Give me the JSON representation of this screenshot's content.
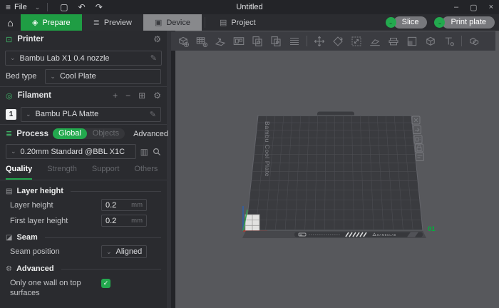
{
  "titlebar": {
    "menu": "File",
    "title": "Untitled"
  },
  "nav": {
    "prepare": "Prepare",
    "preview": "Preview",
    "device": "Device",
    "project": "Project",
    "slice": "Slice",
    "print_plate": "Print plate"
  },
  "printer": {
    "title": "Printer",
    "model": "Bambu Lab X1 0.4 nozzle",
    "bed_type_label": "Bed type",
    "bed_type_value": "Cool Plate"
  },
  "filament": {
    "title": "Filament",
    "slot": "1",
    "material": "Bambu PLA Matte"
  },
  "process": {
    "title": "Process",
    "scope_global": "Global",
    "scope_objects": "Objects",
    "advanced_label": "Advanced",
    "preset": "0.20mm Standard @BBL X1C",
    "tab_quality": "Quality",
    "tab_strength": "Strength",
    "tab_support": "Support",
    "tab_others": "Others"
  },
  "quality": {
    "group_layer_height": "Layer height",
    "layer_height_label": "Layer height",
    "layer_height_value": "0.2",
    "layer_height_unit": "mm",
    "first_layer_label": "First layer height",
    "first_layer_value": "0.2",
    "first_layer_unit": "mm",
    "group_seam": "Seam",
    "seam_position_label": "Seam position",
    "seam_position_value": "Aligned",
    "group_advanced": "Advanced",
    "only_one_wall_label": "Only one wall on top surfaces"
  },
  "viewport": {
    "plate_type": "Bambu Cool Plate",
    "plate_number": "01",
    "brand": "BAMBULAB"
  },
  "colors": {
    "accent_green": "#23a94e",
    "tab_green": "#1f9d44",
    "viewport_bg": "#57585c",
    "plate_bg": "#3a3b3f",
    "plate_grid": "#515256"
  }
}
